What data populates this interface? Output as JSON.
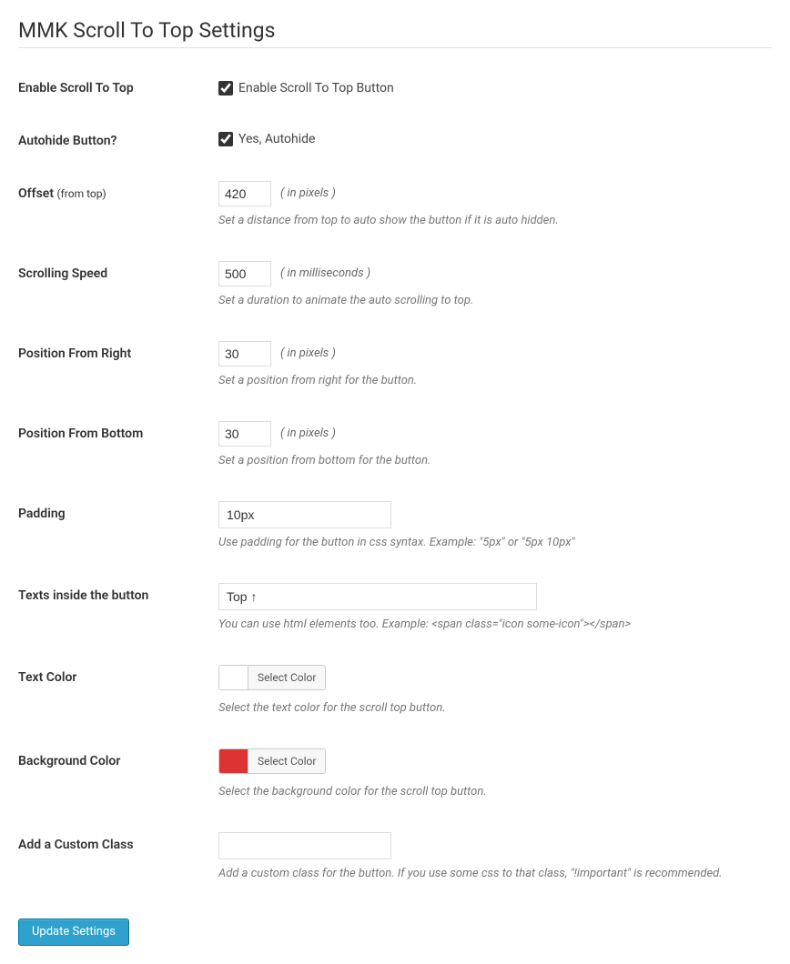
{
  "page_title": "MMK Scroll To Top Settings",
  "fields": {
    "enable": {
      "label": "Enable Scroll To Top",
      "checkbox_label": "Enable Scroll To Top Button",
      "checked": true
    },
    "autohide": {
      "label": "Autohide Button?",
      "checkbox_label": "Yes, Autohide",
      "checked": true
    },
    "offset": {
      "label": "Offset",
      "label_small": "(from top)",
      "value": "420",
      "unit": "( in pixels )",
      "description": "Set a distance from top to auto show the button if it is auto hidden."
    },
    "speed": {
      "label": "Scrolling Speed",
      "value": "500",
      "unit": "( in milliseconds )",
      "description": "Set a duration to animate the auto scrolling to top."
    },
    "pos_right": {
      "label": "Position From Right",
      "value": "30",
      "unit": "( in pixels )",
      "description": "Set a position from right for the button."
    },
    "pos_bottom": {
      "label": "Position From Bottom",
      "value": "30",
      "unit": "( in pixels )",
      "description": "Set a position from bottom for the button."
    },
    "padding": {
      "label": "Padding",
      "value": "10px",
      "description": "Use padding for the button in css syntax. Example: \"5px\" or \"5px 10px\""
    },
    "texts": {
      "label": "Texts inside the button",
      "value": "Top ↑",
      "description": "You can use html elements too. Example: <span class=\"icon some-icon\"></span>"
    },
    "text_color": {
      "label": "Text Color",
      "button": "Select Color",
      "swatch": "#ffffff",
      "description": "Select the text color for the scroll top button."
    },
    "bg_color": {
      "label": "Background Color",
      "button": "Select Color",
      "swatch": "#dd3333",
      "description": "Select the background color for the scroll top button."
    },
    "custom_class": {
      "label": "Add a Custom Class",
      "value": "",
      "description": "Add a custom class for the button. If you use some css to that class, \"!important\" is recommended."
    }
  },
  "submit_label": "Update Settings"
}
